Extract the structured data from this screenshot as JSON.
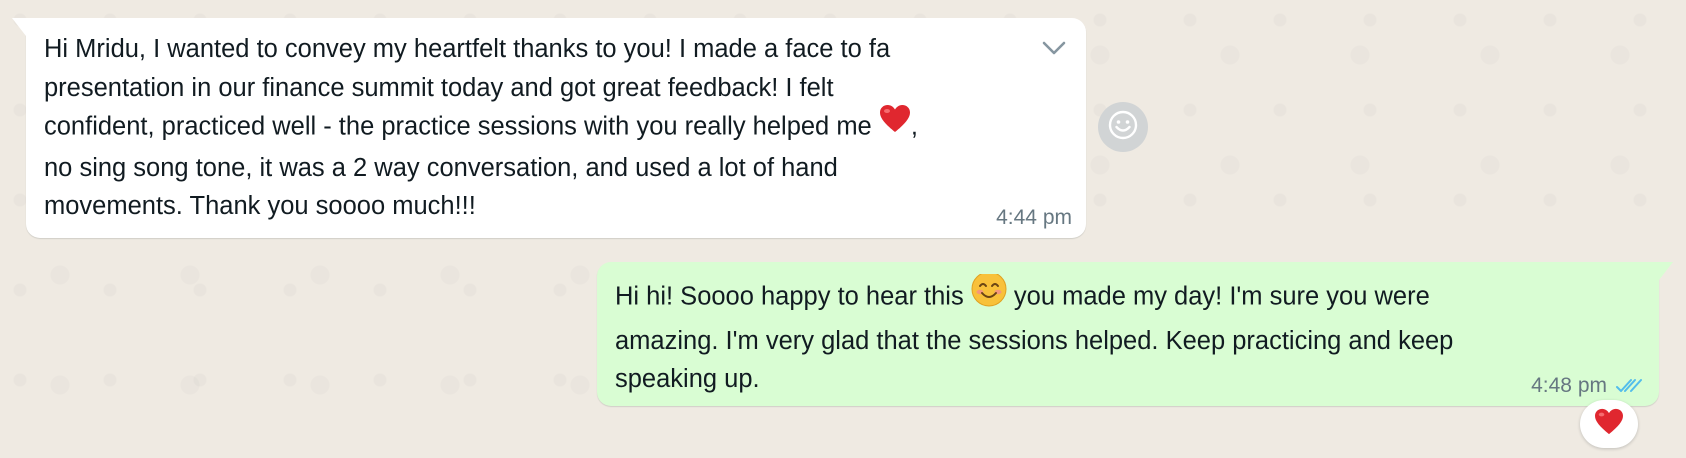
{
  "incoming": {
    "lines": [
      "Hi Mridu, I wanted to convey my heartfelt thanks to you! I made a face to fa",
      "presentation in our finance summit today and got great feedback! I felt",
      "confident, practiced well - the practice sessions with you really helped me",
      ",",
      "no sing song tone, it was a 2 way conversation, and used a lot of hand",
      "movements. Thank you soooo much!!!"
    ],
    "time": "4:44 pm",
    "menu_icon": "chevron-down-icon",
    "inline_emoji": "red-heart"
  },
  "react_button": {
    "icon": "smiley-icon"
  },
  "outgoing": {
    "line1_before": "Hi hi! Soooo happy to hear this ",
    "line1_after": " you made my day! I'm sure you were",
    "lines": [
      "amazing. I'm very glad that the sessions helped. Keep practicing and keep",
      "speaking up."
    ],
    "time": "4:48 pm",
    "status": "read",
    "inline_emoji": "smiling-face"
  },
  "reaction": {
    "emoji": "red-heart"
  },
  "colors": {
    "background": "#efeae2",
    "incoming_bubble": "#ffffff",
    "outgoing_bubble": "#d9fdd3",
    "timestamp": "#667781",
    "read_ticks": "#53bdeb",
    "heart": "#e0272f",
    "smiley": "#f8c13a"
  }
}
